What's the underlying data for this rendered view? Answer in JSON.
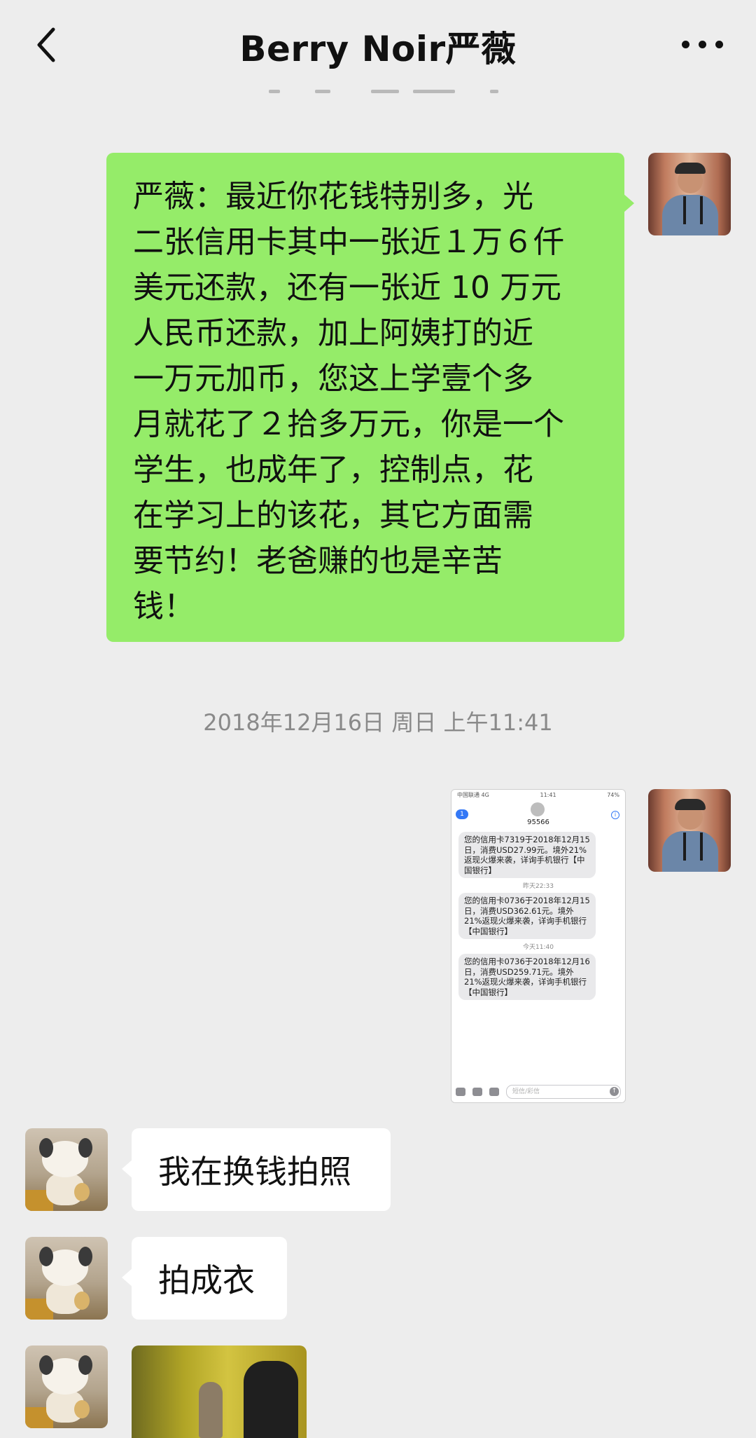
{
  "header": {
    "title": "Berry Noir严薇"
  },
  "messages": {
    "long": {
      "text": "严薇：最近你花钱特别多，光\n二张信用卡其中一张近１万６仟\n美元还款，还有一张近 10 万元\n人民币还款，加上阿姨打的近\n一万元加币，您这上学壹个多\n月就花了２拾多万元，你是一个\n学生，也成年了，控制点，花\n在学习上的该花，其它方面需\n要节约！老爸赚的也是辛苦\n钱！"
    },
    "timestamp": "2018年12月16日 周日 上午11:41",
    "reply1": "我在换钱拍照",
    "reply2": "拍成衣"
  },
  "sms_screenshot": {
    "status_carrier": "中国联通 4G",
    "status_time": "11:41",
    "status_battery": "74%",
    "back_badge": "1",
    "number": "95566",
    "info": "i",
    "messages": [
      {
        "time": "",
        "text": "您的信用卡7319于2018年12月15日，消费USD27.99元。境外21%返现火爆来袭，详询手机银行【中国银行】"
      },
      {
        "time": "昨天22:33",
        "text": "您的信用卡0736于2018年12月15日，消费USD362.61元。境外21%返现火爆来袭，详询手机银行【中国银行】"
      },
      {
        "time": "今天11:40",
        "text": "您的信用卡0736于2018年12月16日，消费USD259.71元。境外21%返现火爆来袭，详询手机银行【中国银行】"
      }
    ],
    "input_placeholder": "短信/彩信",
    "send": "↑"
  }
}
